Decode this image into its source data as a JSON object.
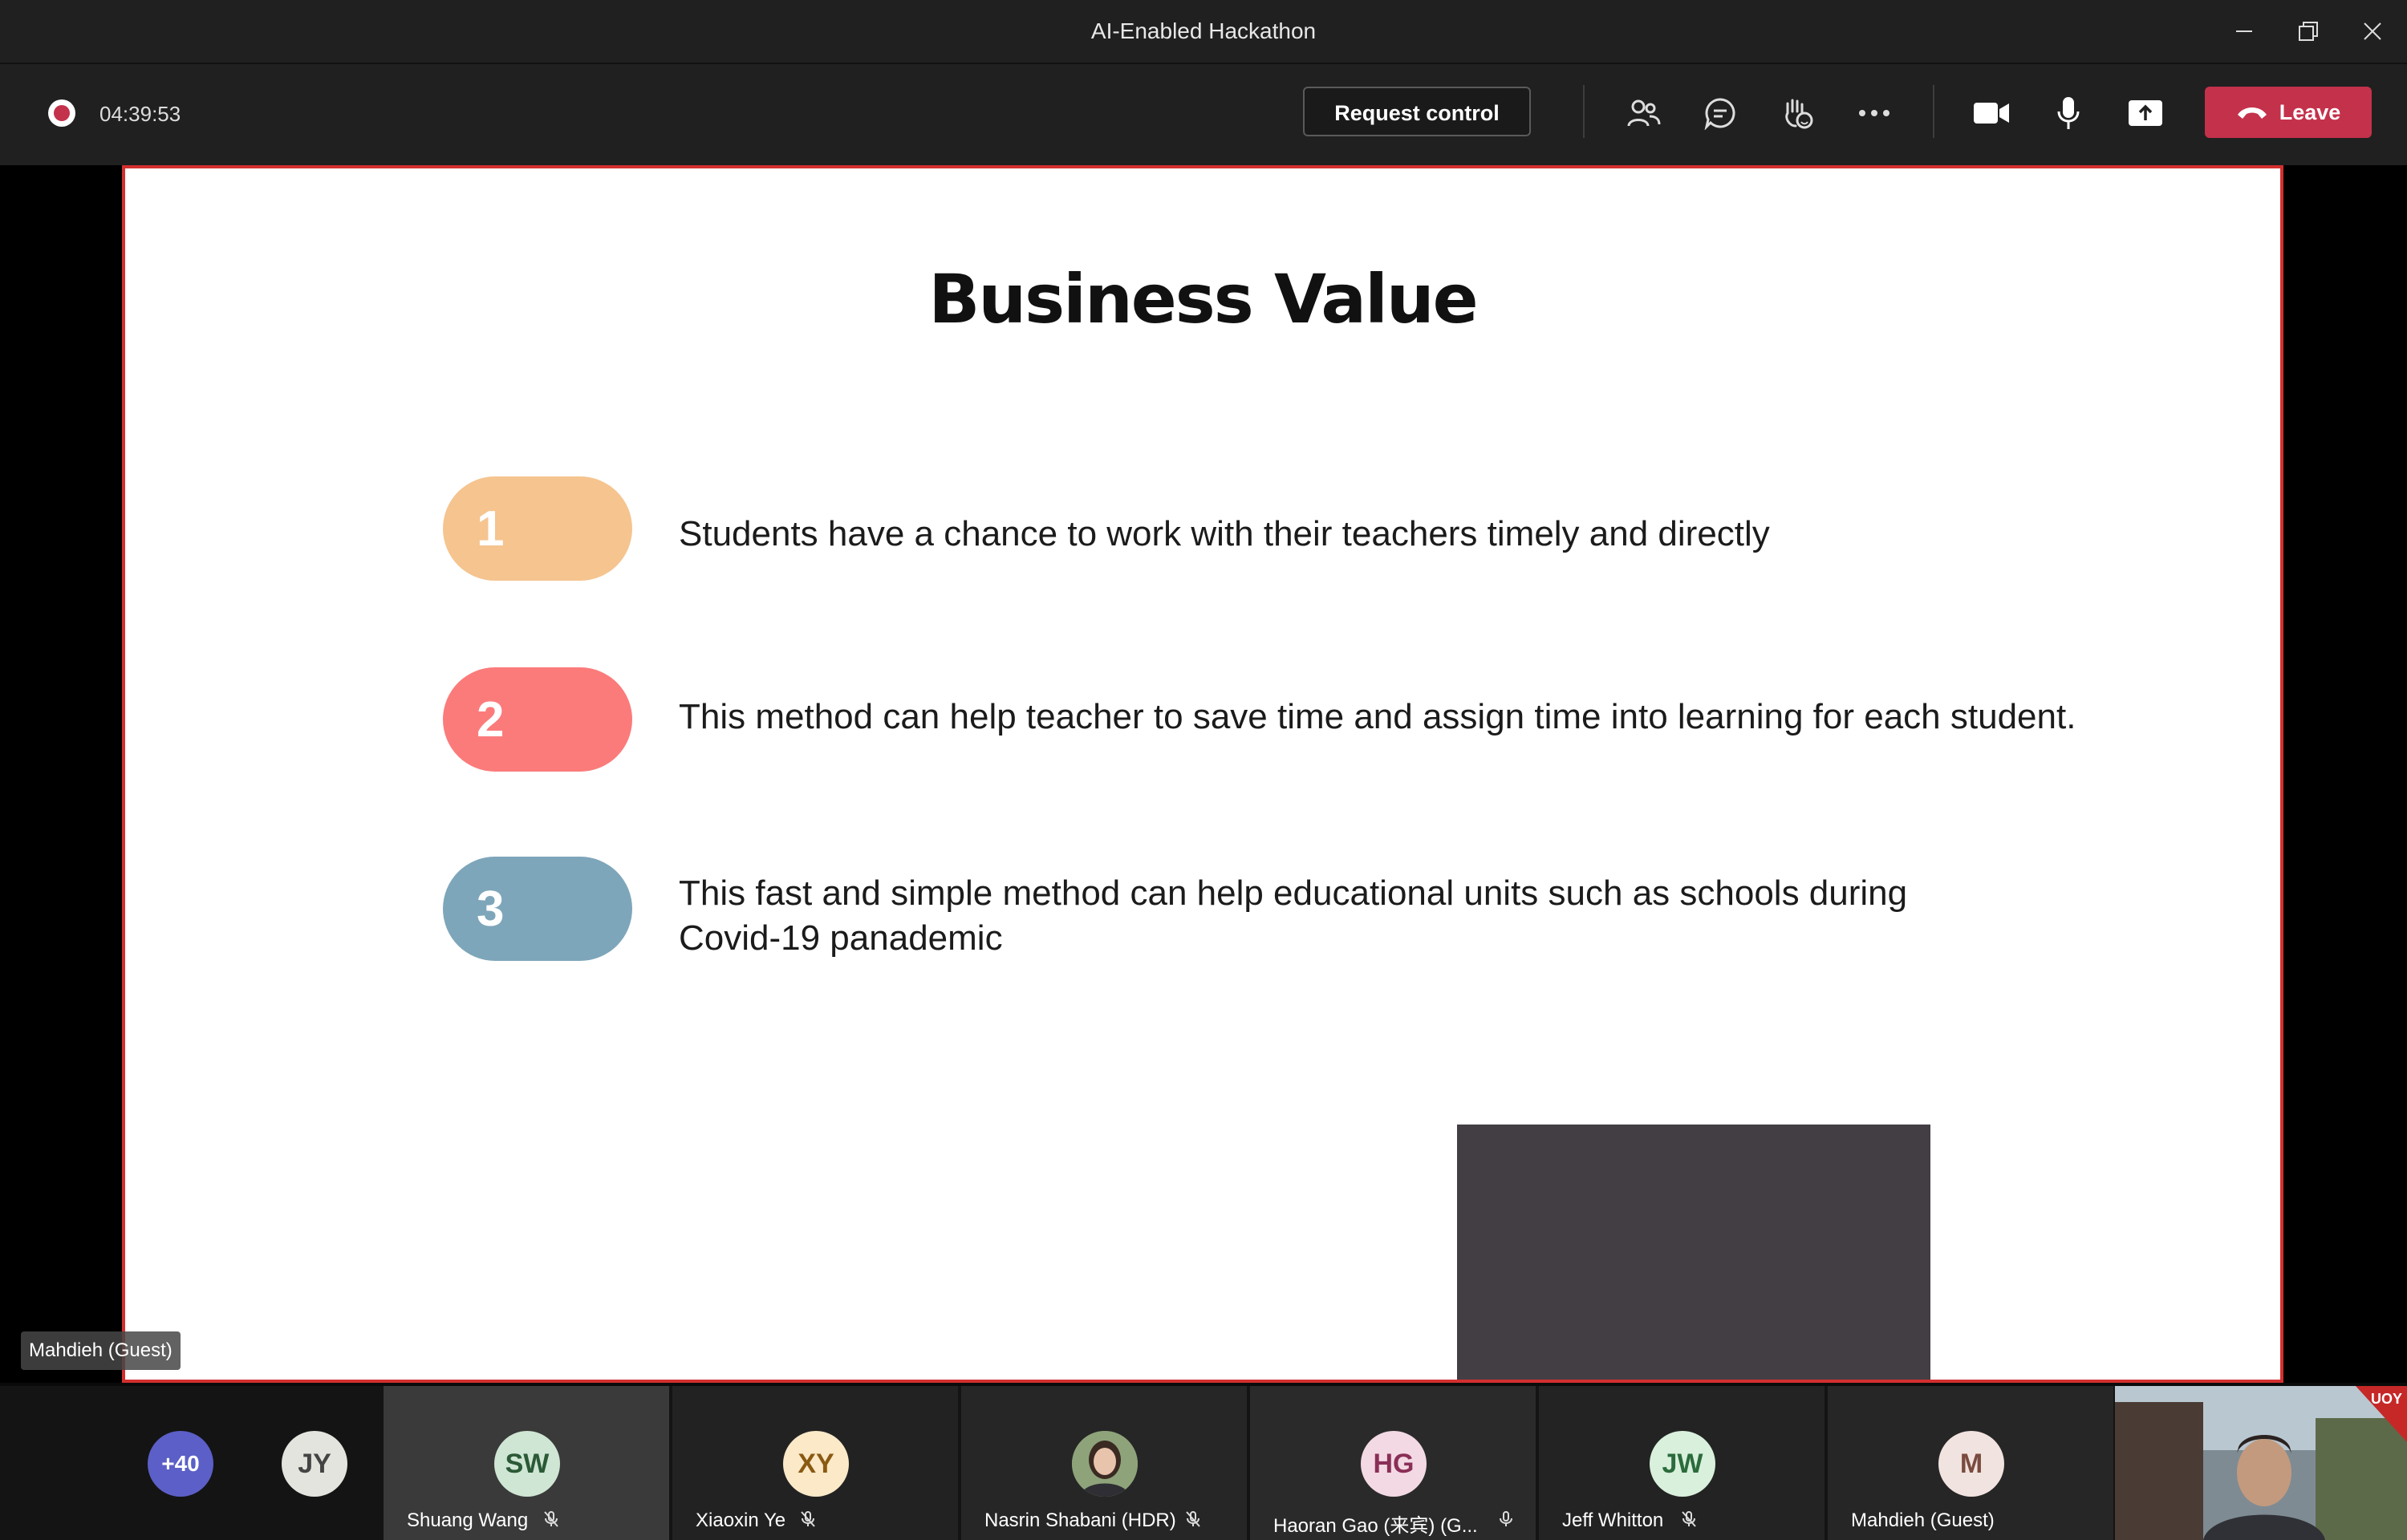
{
  "window": {
    "title": "AI-Enabled Hackathon"
  },
  "toolbar": {
    "timer": "04:39:53",
    "request_control": "Request control",
    "leave": "Leave"
  },
  "icons": [
    "record-indicator",
    "people-icon",
    "chat-icon",
    "raise-hand-icon",
    "more-icon",
    "camera-icon",
    "mic-icon",
    "share-icon",
    "phone-icon"
  ],
  "slide": {
    "title": "Business Value",
    "points": [
      {
        "number": "1",
        "color": "#f5c48f",
        "text": "Students have a chance to work with their teachers timely and directly"
      },
      {
        "number": "2",
        "color": "#fb7b7b",
        "text": "This method can help teacher to save time and assign time into learning for each student."
      },
      {
        "number": "3",
        "color": "#7ea6ba",
        "text": "This fast and simple method can help educational units such as schools during Covid-19 panademic"
      }
    ]
  },
  "speaker_label": "Mahdieh (Guest)",
  "participants": {
    "overflow": "+40",
    "list": [
      {
        "initials": "JY",
        "name": "",
        "bg": "#e4e4de",
        "fg": "#444"
      },
      {
        "initials": "SW",
        "name": "Shuang Wang",
        "bg": "#cfe6d4",
        "fg": "#2a5a36"
      },
      {
        "initials": "XY",
        "name": "Xiaoxin Ye",
        "bg": "#fbe9c8",
        "fg": "#8a5a12"
      },
      {
        "initials": "",
        "name": "Nasrin Shabani (HDR)",
        "bg": "#7a8f6a",
        "fg": "#fff"
      },
      {
        "initials": "HG",
        "name": "Haoran Gao (来宾) (G...",
        "bg": "#f3d9e4",
        "fg": "#8a2f57"
      },
      {
        "initials": "JW",
        "name": "Jeff Whitton",
        "bg": "#d9f0dc",
        "fg": "#2b6b3c"
      },
      {
        "initials": "M",
        "name": "Mahdieh (Guest)",
        "bg": "#f1e3df",
        "fg": "#7a4b3f"
      }
    ]
  },
  "self_view": {
    "badge": "UOY"
  }
}
